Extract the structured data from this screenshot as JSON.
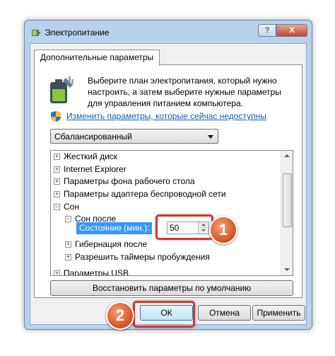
{
  "window": {
    "title": "Электропитание",
    "help_label": "?",
    "close_label": "X"
  },
  "tab": {
    "label": "Дополнительные параметры"
  },
  "description": "Выберите план электропитания, который нужно настроить, а затем выберите нужные параметры для управления питанием компьютера.",
  "change_link": "Изменить параметры, которые сейчас недоступны",
  "plan_select": {
    "value": "Сбалансированный"
  },
  "tree": {
    "items": [
      {
        "label": "Жесткий диск",
        "expander": "+"
      },
      {
        "label": "Internet Explorer",
        "expander": "+"
      },
      {
        "label": "Параметры фона рабочего стола",
        "expander": "+"
      },
      {
        "label": "Параметры адаптера беспроводной сети",
        "expander": "+"
      },
      {
        "label": "Сон",
        "expander": "−"
      },
      {
        "label": "Сон после",
        "expander": "−"
      },
      {
        "label": "Состояние (мин.):"
      },
      {
        "label": "Гибернация после",
        "expander": "+"
      },
      {
        "label": "Разрешить таймеры пробуждения",
        "expander": "+"
      },
      {
        "label": "Параметры USB",
        "expander": "+"
      }
    ],
    "sleep_after_value": "50"
  },
  "buttons": {
    "restore": "Восстановить параметры по умолчанию",
    "ok": "ОК",
    "cancel": "Отмена",
    "apply": "Применить"
  },
  "annotations": {
    "step1": "1",
    "step2": "2"
  },
  "colors": {
    "highlight": "#d03a2c",
    "badge": "#dc5a2a",
    "selection": "#3399ff",
    "link": "#1160b0"
  }
}
